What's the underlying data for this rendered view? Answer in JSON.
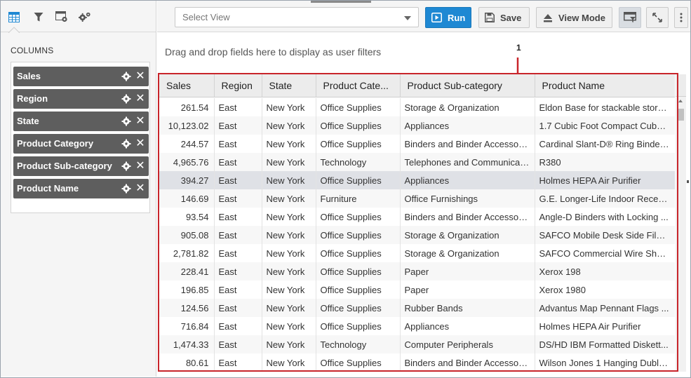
{
  "left_panel": {
    "toolbar_icons": [
      "table-icon",
      "filter-icon",
      "view-settings-icon",
      "settings-gears-icon"
    ],
    "columns_title": "COLUMNS",
    "columns": [
      {
        "label": "Sales"
      },
      {
        "label": "Region"
      },
      {
        "label": "State"
      },
      {
        "label": "Product Category"
      },
      {
        "label": "Product Sub-category"
      },
      {
        "label": "Product Name"
      }
    ],
    "pill_close_glyph": "✕"
  },
  "toolbar": {
    "select_view_placeholder": "Select View",
    "run_label": "Run",
    "save_label": "Save",
    "view_mode_label": "View Mode"
  },
  "dropzone_text": "Drag and drop fields here to display as user filters",
  "annotation_label": "1",
  "colors": {
    "accent": "#1e88d3",
    "annotation_red": "#c8252b",
    "pill_bg": "#5e5e5e"
  },
  "grid": {
    "headers": [
      "Sales",
      "Region",
      "State",
      "Product Category",
      "Product Sub-category",
      "Product Name"
    ],
    "header_display": [
      "Sales",
      "Region",
      "State",
      "Product Cate...",
      "Product Sub-category",
      "Product Name"
    ],
    "rows": [
      [
        "261.54",
        "East",
        "New York",
        "Office Supplies",
        "Storage & Organization",
        "Eldon Base for stackable stora..."
      ],
      [
        "10,123.02",
        "East",
        "New York",
        "Office Supplies",
        "Appliances",
        "1.7 Cubic Foot Compact Cube ..."
      ],
      [
        "244.57",
        "East",
        "New York",
        "Office Supplies",
        "Binders and Binder Accessori...",
        "Cardinal Slant-D® Ring Binder, ..."
      ],
      [
        "4,965.76",
        "East",
        "New York",
        "Technology",
        "Telephones and Communicat...",
        "R380"
      ],
      [
        "394.27",
        "East",
        "New York",
        "Office Supplies",
        "Appliances",
        "Holmes HEPA Air Purifier"
      ],
      [
        "146.69",
        "East",
        "New York",
        "Furniture",
        "Office Furnishings",
        "G.E. Longer-Life Indoor Recess..."
      ],
      [
        "93.54",
        "East",
        "New York",
        "Office Supplies",
        "Binders and Binder Accessori...",
        "Angle-D Binders with Locking ..."
      ],
      [
        "905.08",
        "East",
        "New York",
        "Office Supplies",
        "Storage & Organization",
        "SAFCO Mobile Desk Side File, ..."
      ],
      [
        "2,781.82",
        "East",
        "New York",
        "Office Supplies",
        "Storage & Organization",
        "SAFCO Commercial Wire Shelv..."
      ],
      [
        "228.41",
        "East",
        "New York",
        "Office Supplies",
        "Paper",
        "Xerox 198"
      ],
      [
        "196.85",
        "East",
        "New York",
        "Office Supplies",
        "Paper",
        "Xerox 1980"
      ],
      [
        "124.56",
        "East",
        "New York",
        "Office Supplies",
        "Rubber Bands",
        "Advantus Map Pennant Flags ..."
      ],
      [
        "716.84",
        "East",
        "New York",
        "Office Supplies",
        "Appliances",
        "Holmes HEPA Air Purifier"
      ],
      [
        "1,474.33",
        "East",
        "New York",
        "Technology",
        "Computer Peripherals",
        "DS/HD IBM Formatted Diskett..."
      ],
      [
        "80.61",
        "East",
        "New York",
        "Office Supplies",
        "Binders and Binder Accessori...",
        "Wilson Jones 1 Hanging DublL..."
      ]
    ],
    "selected_row_index": 4
  }
}
